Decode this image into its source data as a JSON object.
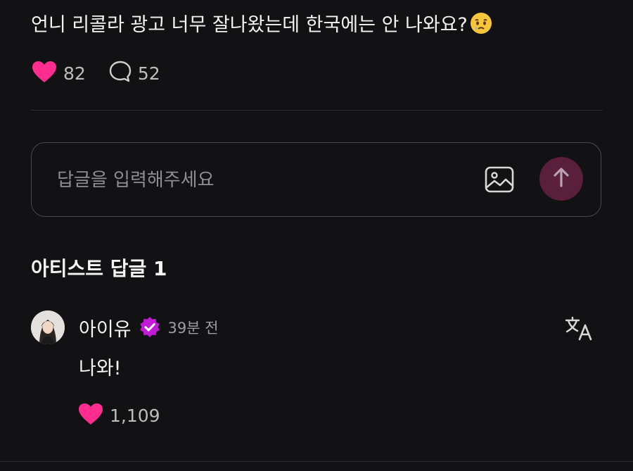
{
  "post": {
    "text": "언니 리콜라 광고 너무 잘나왔는데 한국에는 안 나와요?",
    "emoji": "crying-face-emoji",
    "likes": "82",
    "comments": "52"
  },
  "reply_input": {
    "placeholder": "답글을 입력해주세요"
  },
  "artist_replies": {
    "title": "아티스트 답글 1",
    "items": [
      {
        "author": "아이유",
        "verified": true,
        "time": "39분 전",
        "text": "나와!",
        "likes": "1,109"
      }
    ]
  },
  "colors": {
    "background": "#121113",
    "heart": "#ff2d8f",
    "verified_badge": "#c21bd6",
    "send_button": "#5a1f3a"
  }
}
